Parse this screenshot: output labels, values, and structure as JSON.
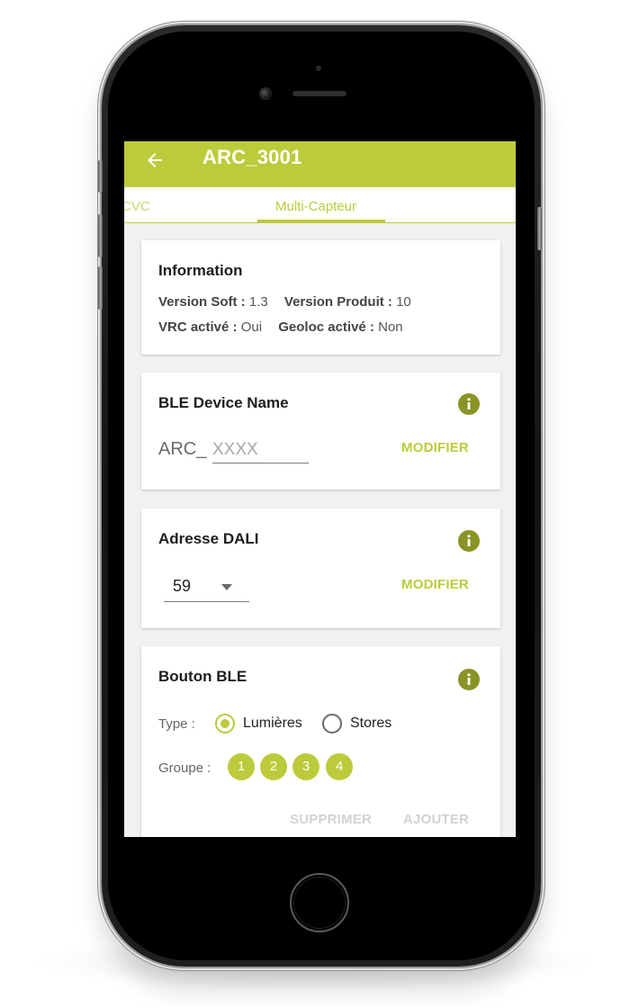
{
  "appbar": {
    "title": "ARC_3001",
    "back_icon": "arrow-left-icon"
  },
  "tabs": [
    {
      "label": "CVC",
      "active": false
    },
    {
      "label": "Multi-Capteur",
      "active": true
    }
  ],
  "information": {
    "title": "Information",
    "version_soft_label": "Version Soft :",
    "version_soft_value": "1.3",
    "version_produit_label": "Version Produit :",
    "version_produit_value": "10",
    "vrc_label": "VRC activé :",
    "vrc_value": "Oui",
    "geoloc_label": "Geoloc activé :",
    "geoloc_value": "Non"
  },
  "ble_device": {
    "title": "BLE Device Name",
    "prefix": "ARC_",
    "placeholder": "XXXX",
    "value": "",
    "action": "MODIFIER",
    "info_icon": "info-icon"
  },
  "dali": {
    "title": "Adresse DALI",
    "selected": "59",
    "action": "MODIFIER",
    "info_icon": "info-icon"
  },
  "bouton_ble": {
    "title": "Bouton BLE",
    "type_label": "Type :",
    "options": [
      {
        "label": "Lumières",
        "selected": true
      },
      {
        "label": "Stores",
        "selected": false
      }
    ],
    "groupe_label": "Groupe :",
    "groups": [
      "1",
      "2",
      "3",
      "4"
    ],
    "delete": "SUPPRIMER",
    "add": "AJOUTER",
    "info_icon": "info-icon"
  },
  "colors": {
    "accent": "#bccb3b",
    "info_icon": "#8a9426",
    "screen_bg": "#f1f1f1"
  }
}
